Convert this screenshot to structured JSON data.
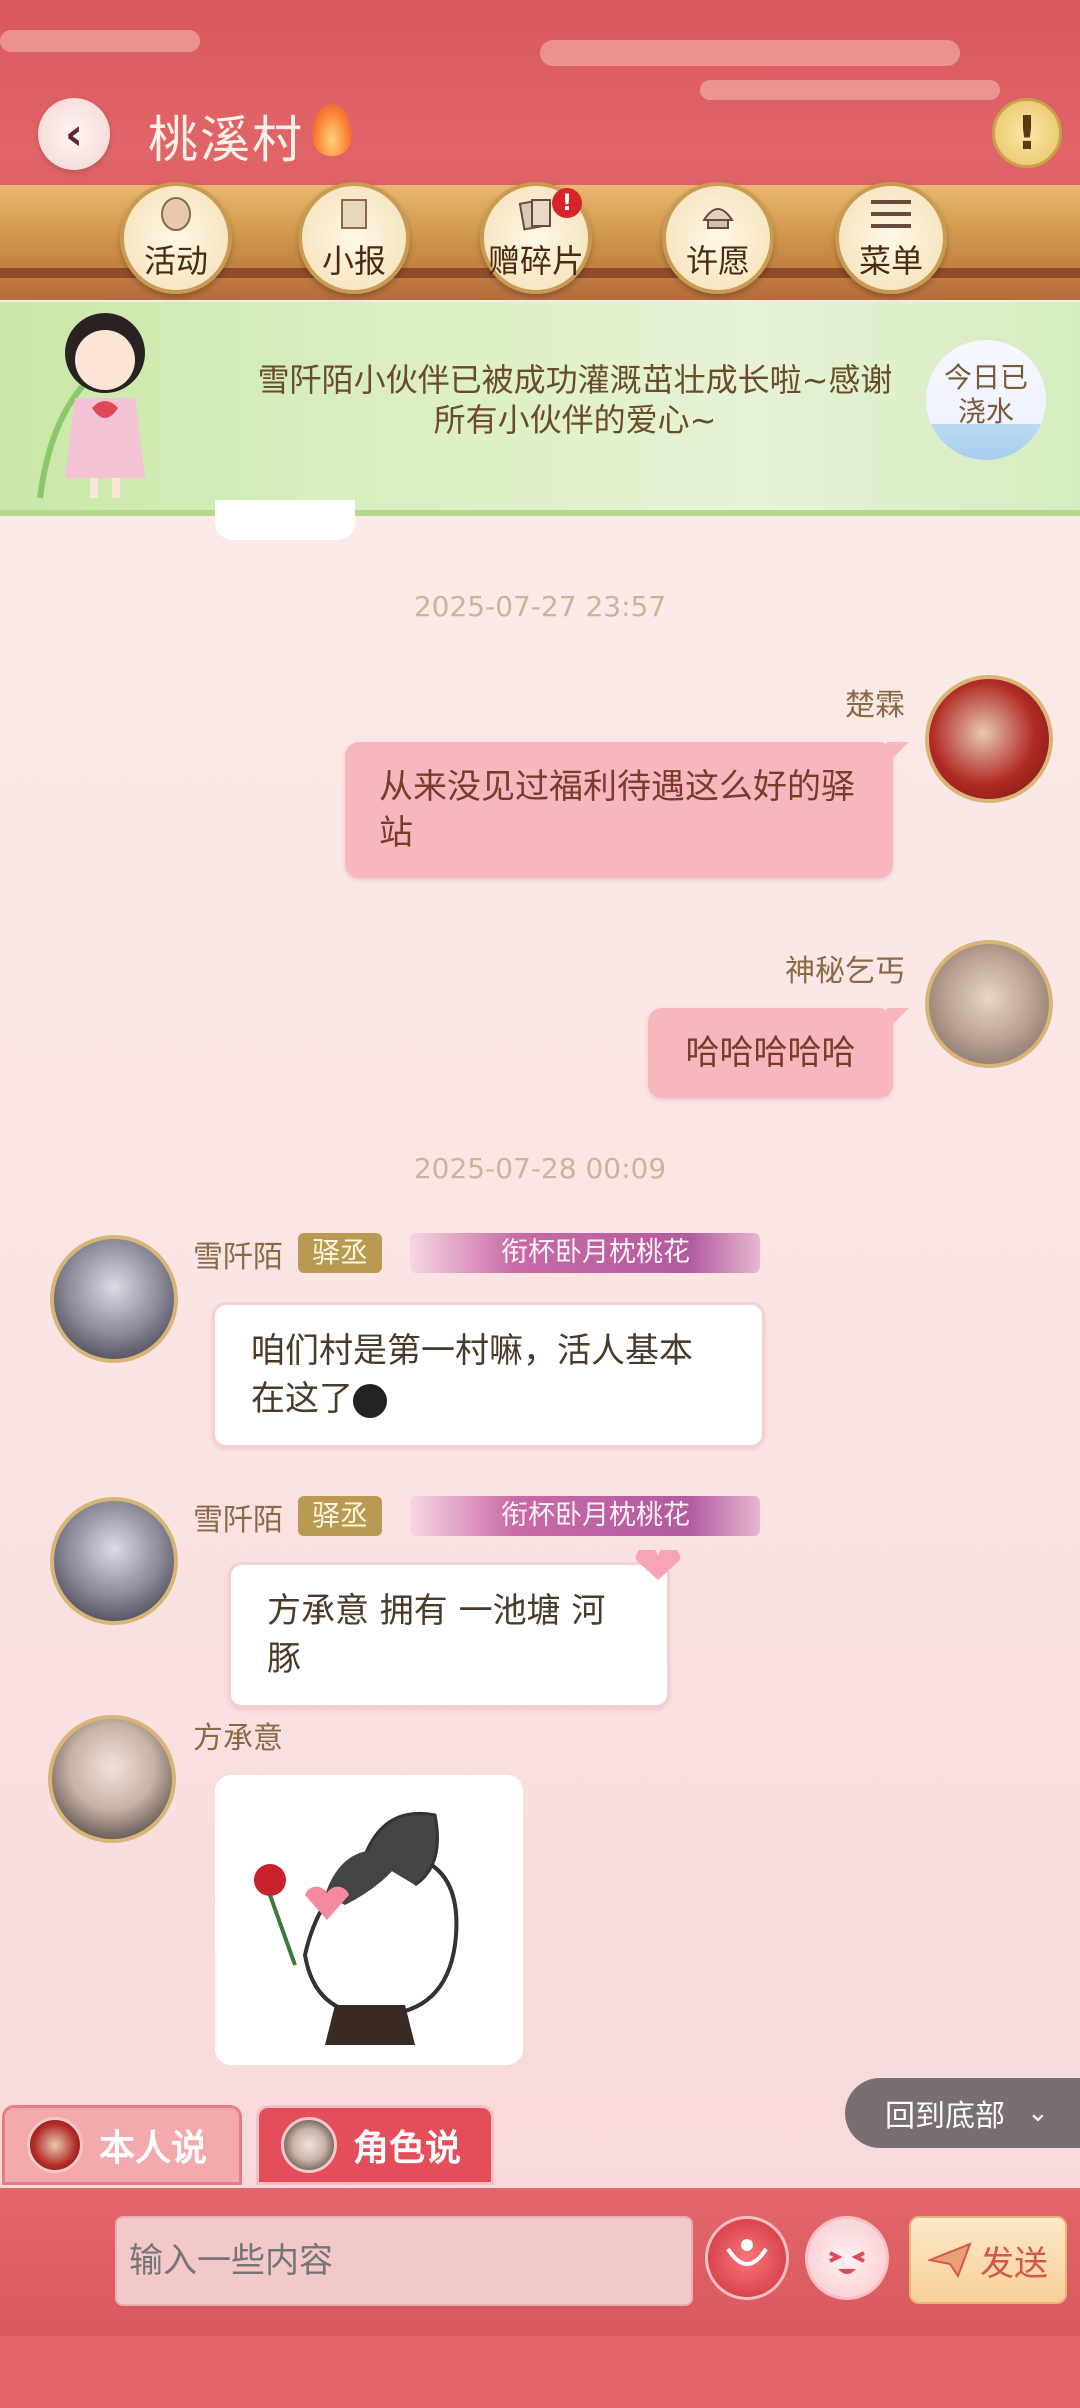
{
  "header": {
    "title": "桃溪村",
    "menu": [
      {
        "label": "活动",
        "icon": "lantern-icon"
      },
      {
        "label": "小报",
        "icon": "scroll-icon"
      },
      {
        "label": "赠碎片",
        "icon": "cards-icon",
        "badge": "!"
      },
      {
        "label": "许愿",
        "icon": "fountain-icon"
      },
      {
        "label": "菜单",
        "icon": "hamburger-icon"
      }
    ]
  },
  "notice": {
    "text": "雪阡陌小伙伴已被成功灌溉茁壮成长啦~感谢所有小伙伴的爱心~",
    "watered_badge": "今日已浇水"
  },
  "chat": {
    "timestamp_1": "2025-07-27 23:57",
    "msg_1": {
      "sender": "楚霖",
      "text": "从来没见过福利待遇这么好的驿站"
    },
    "msg_2": {
      "sender": "神秘乞丐",
      "text": "哈哈哈哈哈"
    },
    "timestamp_2": "2025-07-28 00:09",
    "msg_3": {
      "sender": "雪阡陌",
      "role": "驿丞",
      "title": "衔杯卧月枕桃花",
      "text": "咱们村是第一村嘛，活人基本在这了"
    },
    "msg_4": {
      "sender": "雪阡陌",
      "role": "驿丞",
      "title": "衔杯卧月枕桃花",
      "text": "方承意 拥有 一池塘 河豚"
    },
    "msg_5": {
      "sender": "方承意",
      "sticker": "rose-sticker"
    }
  },
  "controls": {
    "scroll_to_bottom": "回到底部",
    "tab_self": "本人说",
    "tab_role": "角色说",
    "input_placeholder": "输入一些内容",
    "send_label": "发送"
  },
  "colors": {
    "accent_red": "#d9585e",
    "bubble_pink": "#f8b6bf",
    "role_gold": "#b99a52"
  }
}
